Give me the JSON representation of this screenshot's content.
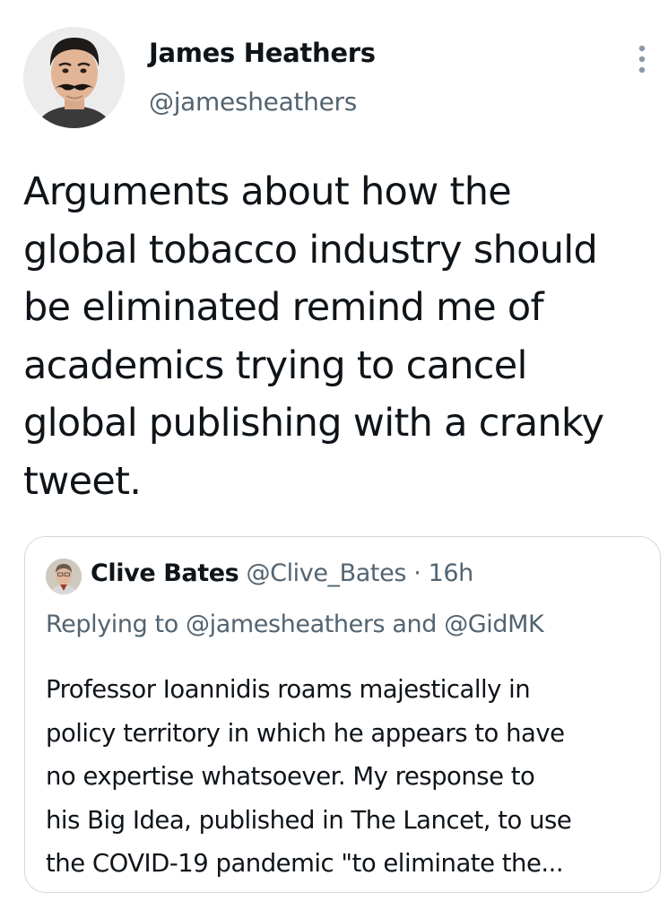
{
  "author": {
    "name": "James Heathers",
    "handle": "@jamesheathers"
  },
  "tweet": {
    "lines": [
      "Arguments about how the",
      "global tobacco industry should",
      "be eliminated remind me of",
      "academics trying to cancel",
      "global publishing with a cranky",
      "tweet."
    ]
  },
  "quote": {
    "name": "Clive Bates",
    "handle": "@Clive_Bates",
    "separator": "·",
    "time": "16h",
    "replying_prefix": "Replying to",
    "reply_mention_1": "@jamesheathers",
    "reply_and": "and",
    "reply_mention_2": "@GidMK",
    "lines": [
      "Professor Ioannidis roams majestically in",
      "policy territory in which he appears to have",
      "no expertise whatsoever.  My response to",
      "his Big Idea, published in The Lancet, to use",
      "the COVID-19 pandemic \"to eliminate the..."
    ]
  },
  "icons": {
    "more": "more-vertical-icon",
    "author_avatar": "avatar",
    "quote_avatar": "avatar"
  },
  "colors": {
    "text": "#0f1419",
    "secondary": "#536471",
    "border": "#cfd9de"
  }
}
